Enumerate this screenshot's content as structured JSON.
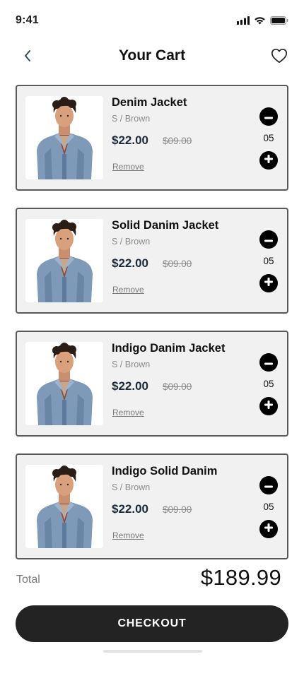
{
  "status_bar": {
    "time": "9:41",
    "icons": [
      "signal-icon",
      "wifi-icon",
      "battery-icon"
    ]
  },
  "header": {
    "title": "Your Cart",
    "back_icon": "chevron-left-icon",
    "favorite_icon": "heart-outline-icon"
  },
  "cart": {
    "items": [
      {
        "name": "Denim Jacket",
        "variant": "S / Brown",
        "price": "$22.00",
        "old_price": "$09.00",
        "remove_label": "Remove",
        "quantity": "05"
      },
      {
        "name": "Solid Danim Jacket",
        "variant": "S / Brown",
        "price": "$22.00",
        "old_price": "$09.00",
        "remove_label": "Remove",
        "quantity": "05"
      },
      {
        "name": "Indigo Danim Jacket",
        "variant": "S / Brown",
        "price": "$22.00",
        "old_price": "$09.00",
        "remove_label": "Remove",
        "quantity": "05"
      },
      {
        "name": "Indigo Solid Danim",
        "variant": "S / Brown",
        "price": "$22.00",
        "old_price": "$09.00",
        "remove_label": "Remove",
        "quantity": "05"
      }
    ]
  },
  "summary": {
    "total_label": "Total",
    "total_value": "$189.99"
  },
  "checkout": {
    "label": "CHECKOUT"
  },
  "colors": {
    "card_bg": "#f1f1f1",
    "card_border": "#5a5a5a",
    "button_bg": "#232323",
    "price": "#1d2a3a"
  }
}
